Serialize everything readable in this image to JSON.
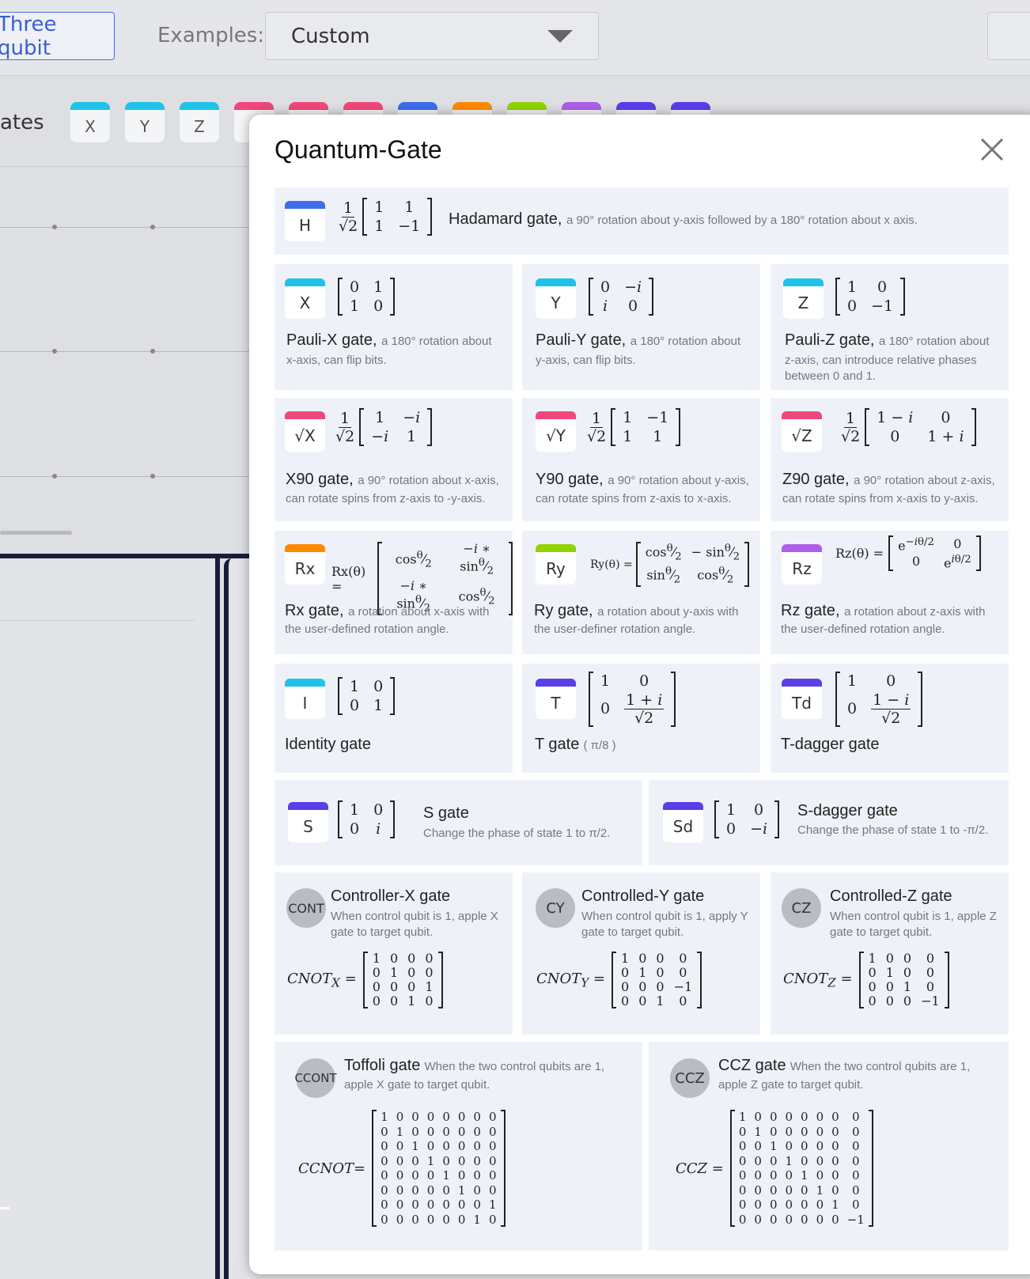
{
  "topbar": {
    "mode_label": "Three qubit",
    "examples_label": "Examples:",
    "examples_value": "Custom"
  },
  "palette": {
    "label": "ates",
    "gates": [
      "X",
      "Y",
      "Z",
      "√"
    ]
  },
  "modal": {
    "title": "Quantum-Gate",
    "gates": {
      "h": {
        "icon": "H",
        "name": "Hadamard gate",
        "desc": "a 90° rotation about y-axis followed by a 180° rotation about x axis."
      },
      "x": {
        "icon": "X",
        "name": "Pauli-X gate",
        "desc": "a 180° rotation about",
        "desc2": "x-axis, can flip bits."
      },
      "y": {
        "icon": "Y",
        "name": "Pauli-Y gate",
        "desc": "a 180° rotation about",
        "desc2": "y-axis, can flip bits."
      },
      "z": {
        "icon": "Z",
        "name": "Pauli-Z gate",
        "desc": "a 180° rotation about",
        "desc2": "z-axis, can introduce relative phases",
        "desc3": "between 0  and 1."
      },
      "x90": {
        "icon": "√X",
        "name": "X90 gate",
        "desc": "a 90° rotation about x-axis,",
        "desc2": "can rotate spins from z-axis to -y-axis."
      },
      "y90": {
        "icon": "√Y",
        "name": "Y90 gate",
        "desc": "a 90° rotation about y-axis,",
        "desc2": "can rotate spins from z-axis to x-axis."
      },
      "z90": {
        "icon": "√Z",
        "name": "Z90 gate",
        "desc": "a 90° rotation about z-axis,",
        "desc2": "can rotate spins from x-axis to y-axis."
      },
      "rx": {
        "icon": "Rx",
        "name": "Rx gate",
        "desc": "a rotation about x-axis with",
        "desc2": "the user-defined rotation angle.",
        "lhs": "Rx(θ) ="
      },
      "ry": {
        "icon": "Ry",
        "name": "Ry gate",
        "desc": "a rotation about y-axis with",
        "desc2": "the user-definer rotation angle.",
        "lhs": "Ry(θ) ="
      },
      "rz": {
        "icon": "Rz",
        "name": "Rz gate",
        "desc": "a rotation about z-axis with",
        "desc2": "the user-defined rotation angle.",
        "lhs": "Rz(θ) ="
      },
      "i": {
        "icon": "I",
        "name": "Identity gate"
      },
      "t": {
        "icon": "T",
        "name": "T gate",
        "desc": "( π/8 )"
      },
      "td": {
        "icon": "Td",
        "name": "T-dagger gate"
      },
      "s": {
        "icon": "S",
        "name": "S gate",
        "desc": "Change the phase of state 1 to π/2."
      },
      "sd": {
        "icon": "Sd",
        "name": "S-dagger gate",
        "desc": "Change the phase of state 1 to -π/2."
      },
      "cx": {
        "icon": "CONT",
        "name": "Controller-X gate",
        "desc": "When control qubit is 1, apple X",
        "desc2": "gate to target qubit.",
        "lhs": "CNOT",
        "sub": "X"
      },
      "cy": {
        "icon": "CY",
        "name": "Controlled-Y gate",
        "desc": "When control qubit is 1, apply Y",
        "desc2": "gate to target qubit.",
        "lhs": "CNOT",
        "sub": "Y"
      },
      "cz": {
        "icon": "CZ",
        "name": "Controlled-Z gate",
        "desc": "When control qubit is 1, apple Z",
        "desc2": "gate to target qubit.",
        "lhs": "CNOT",
        "sub": "Z"
      },
      "ccx": {
        "icon": "CCONT",
        "name": "Toffoli gate",
        "desc": "When the two control qubits are 1,",
        "desc2": "apple X gate to target qubit.",
        "lhs": "CCNOT="
      },
      "ccz": {
        "icon": "CCZ",
        "name": "CCZ gate",
        "desc": "When the two control qubits are 1,",
        "desc2": "apple Z gate to target qubit.",
        "lhs": "CCZ ="
      }
    }
  },
  "colors": {
    "cyan": "#20c3e8",
    "blue": "#3d6ee8",
    "pink": "#f0487a",
    "orange": "#ff8a00",
    "green": "#8fd400",
    "purple": "#b05ee8",
    "indigo": "#5a3ee8"
  }
}
